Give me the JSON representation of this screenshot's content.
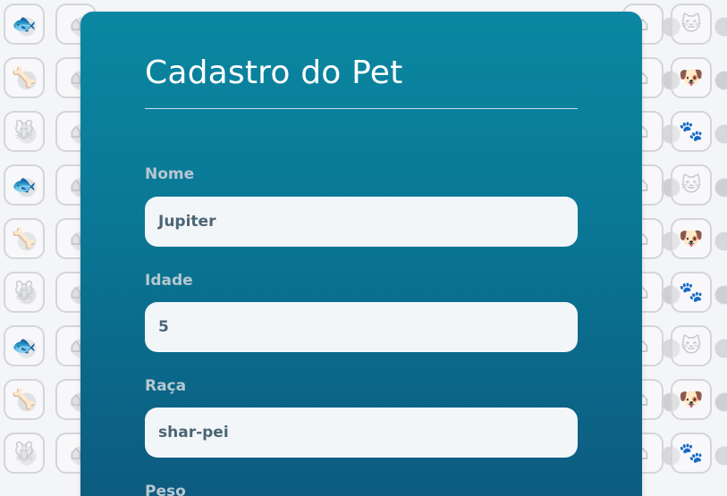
{
  "form": {
    "title": "Cadastro do Pet",
    "fields": [
      {
        "label": "Nome",
        "value": "Jupiter"
      },
      {
        "label": "Idade",
        "value": "5"
      },
      {
        "label": "Raça",
        "value": "shar-pei"
      },
      {
        "label": "Peso",
        "value": ""
      }
    ]
  },
  "colors": {
    "card_gradient_top": "#0a87a2",
    "card_gradient_bottom": "#0d5a7e",
    "input_background": "#f3f6f8",
    "label_color": "#b7c7d0",
    "input_text_color": "#4b6576"
  },
  "background_icons": [
    "fish-icon",
    "bone-icon",
    "mouse-icon",
    "cat-icon",
    "dog-icon",
    "paw-icon",
    "house-icon"
  ]
}
